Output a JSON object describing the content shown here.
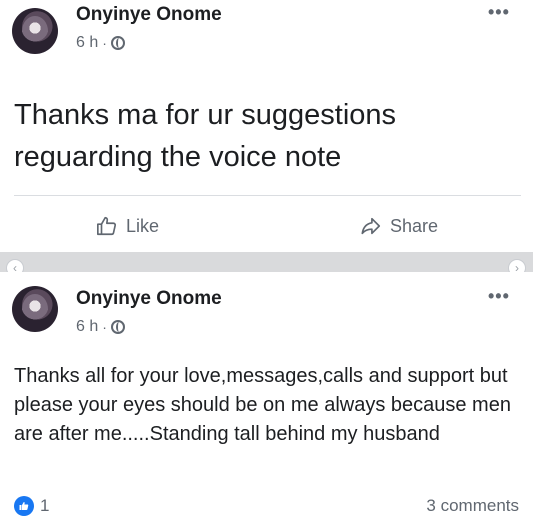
{
  "post1": {
    "author": "Onyinye Onome",
    "time": "6 h",
    "separator": "·",
    "privacy_icon": "globe-icon",
    "more_label": "•••",
    "text": "Thanks ma for ur suggestions reguarding the voice note",
    "actions": {
      "like": "Like",
      "share": "Share"
    }
  },
  "post2": {
    "author": "Onyinye Onome",
    "time": "6 h",
    "separator": "·",
    "privacy_icon": "globe-icon",
    "more_label": "•••",
    "text": "Thanks all for your love,messages,calls and support but please your eyes should be on me always because men are after me.....Standing tall behind my husband",
    "reaction_count": "1",
    "comments": "3 comments"
  },
  "carousel": {
    "prev": "‹",
    "next": "›"
  },
  "colors": {
    "accent": "#1877f2",
    "secondary_text": "#606770",
    "divider": "#dadde1"
  }
}
